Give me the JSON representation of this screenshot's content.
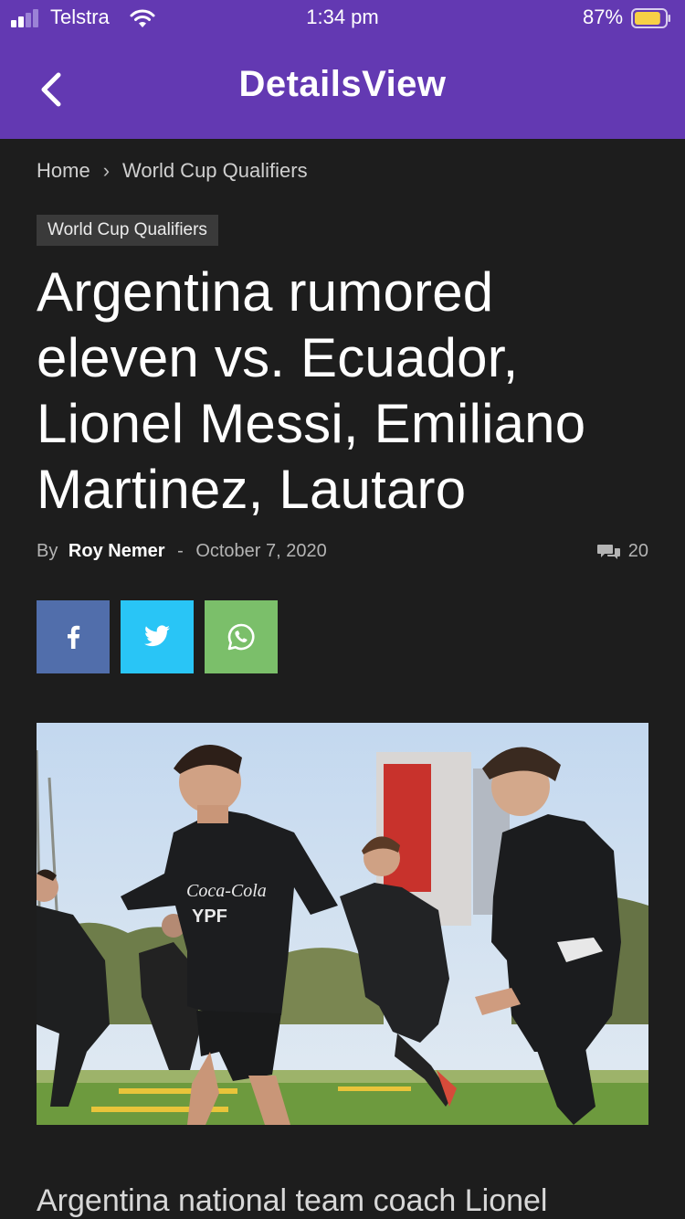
{
  "status_bar": {
    "carrier": "Telstra",
    "time": "1:34 pm",
    "battery_percent": "87%",
    "battery_level": 0.87,
    "signal_icon": "signal-bars-icon",
    "wifi_icon": "wifi-icon",
    "battery_icon": "battery-icon"
  },
  "nav": {
    "title": "DetailsView",
    "back_icon": "chevron-left-icon",
    "background": "#6339b2"
  },
  "breadcrumb": {
    "items": [
      "Home",
      "World Cup Qualifiers"
    ],
    "separator": "›"
  },
  "article": {
    "category": "World Cup Qualifiers",
    "title": "Argentina rumored eleven vs. Ecuador, Lionel Messi, Emiliano Martinez, Lautaro",
    "by_label": "By",
    "author": "Roy Nemer",
    "date_separator": "-",
    "date": "October 7, 2020",
    "comment_count": "20",
    "comment_icon": "comments-icon",
    "lead_text": "Argentina national team coach Lionel"
  },
  "share_buttons": [
    {
      "network": "facebook",
      "icon": "facebook-icon",
      "color": "#516eab"
    },
    {
      "network": "twitter",
      "icon": "twitter-icon",
      "color": "#29c5f6"
    },
    {
      "network": "whatsapp",
      "icon": "whatsapp-icon",
      "color": "#7bbf6a"
    }
  ],
  "photo": {
    "shirt_texts": [
      "Coca-Cola",
      "YPF"
    ]
  }
}
